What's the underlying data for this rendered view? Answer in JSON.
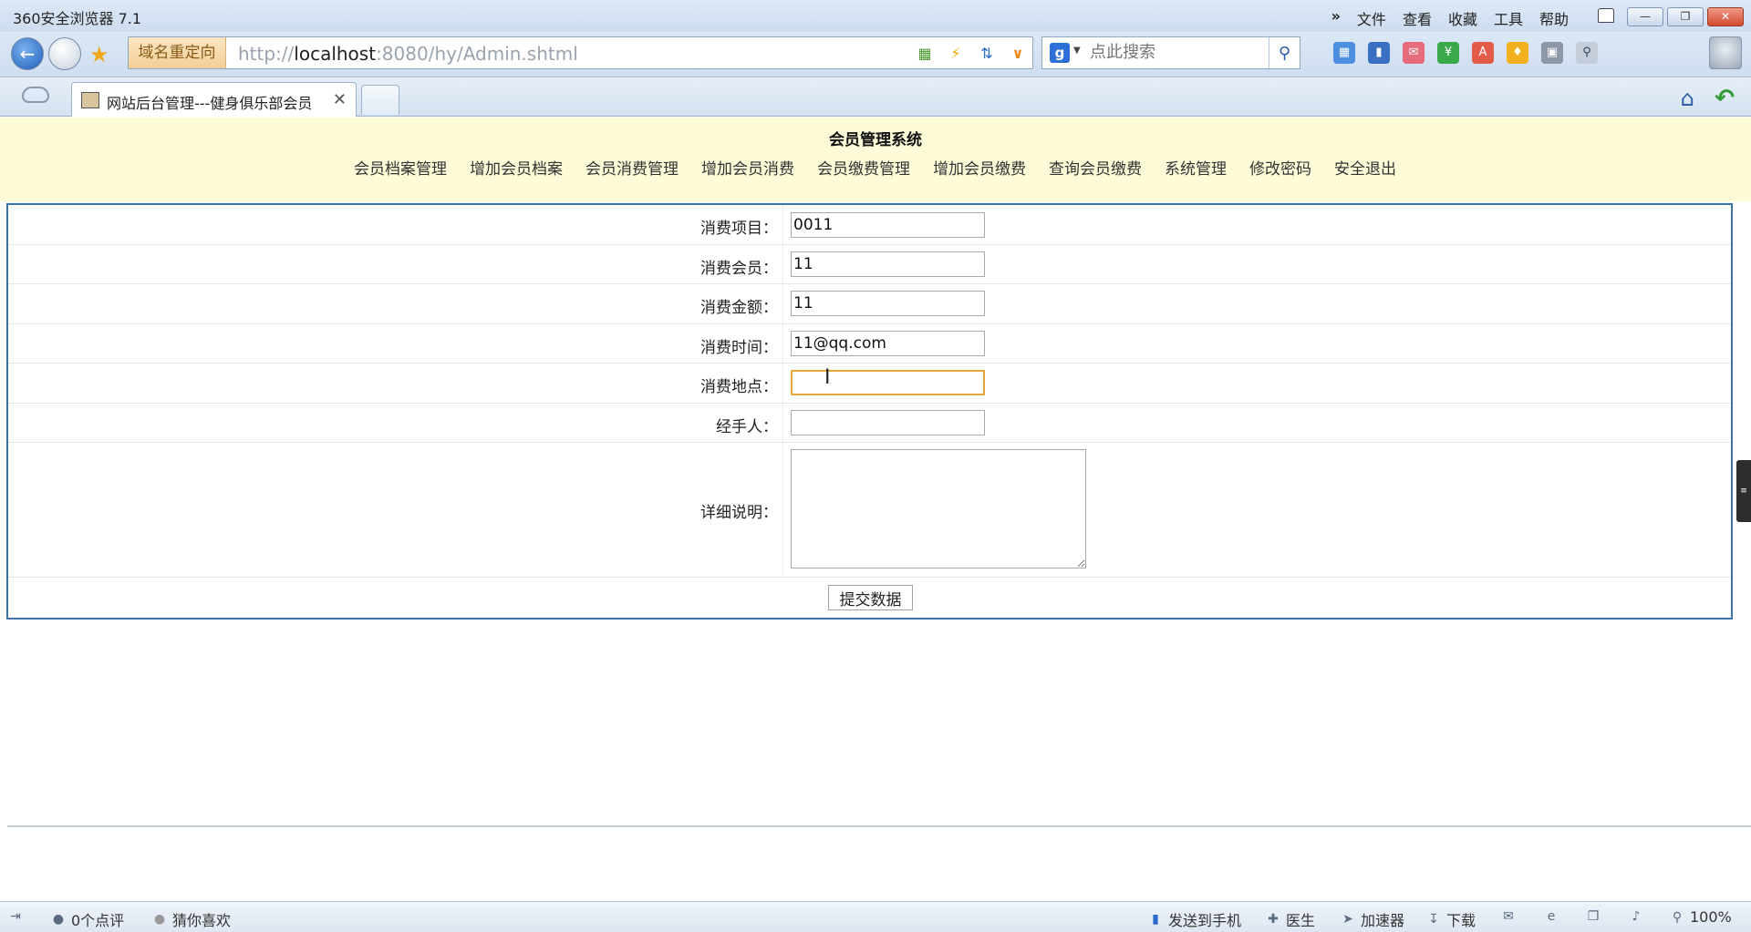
{
  "browser": {
    "app_title": "360安全浏览器 7.1",
    "menu": [
      "文件",
      "查看",
      "收藏",
      "工具",
      "帮助"
    ],
    "menu_more": "»",
    "window_buttons": {
      "minimize": "—",
      "restore": "❐",
      "close": "✕"
    },
    "redirect_tag": "域名重定向",
    "url_scheme": "http://",
    "url_host": "localhost",
    "url_rest": ":8080/hy/Admin.shtml",
    "search_engine": "g",
    "search_placeholder": "点此搜索",
    "tab_title": "网站后台管理---健身俱乐部会员",
    "tab_close": "✕"
  },
  "page": {
    "system_title": "会员管理系统",
    "nav": [
      "会员档案管理",
      "增加会员档案",
      "会员消费管理",
      "增加会员消费",
      "会员缴费管理",
      "增加会员缴费",
      "查询会员缴费",
      "系统管理",
      "修改密码",
      "安全退出"
    ],
    "form": {
      "fields": [
        {
          "label": "消费项目：",
          "value": "0011"
        },
        {
          "label": "消费会员：",
          "value": "11"
        },
        {
          "label": "消费金额：",
          "value": "11"
        },
        {
          "label": "消费时间：",
          "value": "11@qq.com"
        },
        {
          "label": "消费地点：",
          "value": ""
        },
        {
          "label": "经手人：",
          "value": ""
        }
      ],
      "detail_label": "详细说明：",
      "detail_value": "",
      "submit_label": "提交数据"
    }
  },
  "statusbar": {
    "comments": "0个点评",
    "guess": "猜你喜欢",
    "send_to_phone": "发送到手机",
    "doctor": "医生",
    "accelerator": "加速器",
    "download": "下载",
    "zoom": "100%"
  },
  "colors": {
    "header_bg": "#fdfbd8",
    "form_border": "#3d73a8",
    "focus_border": "#e1a93b"
  }
}
